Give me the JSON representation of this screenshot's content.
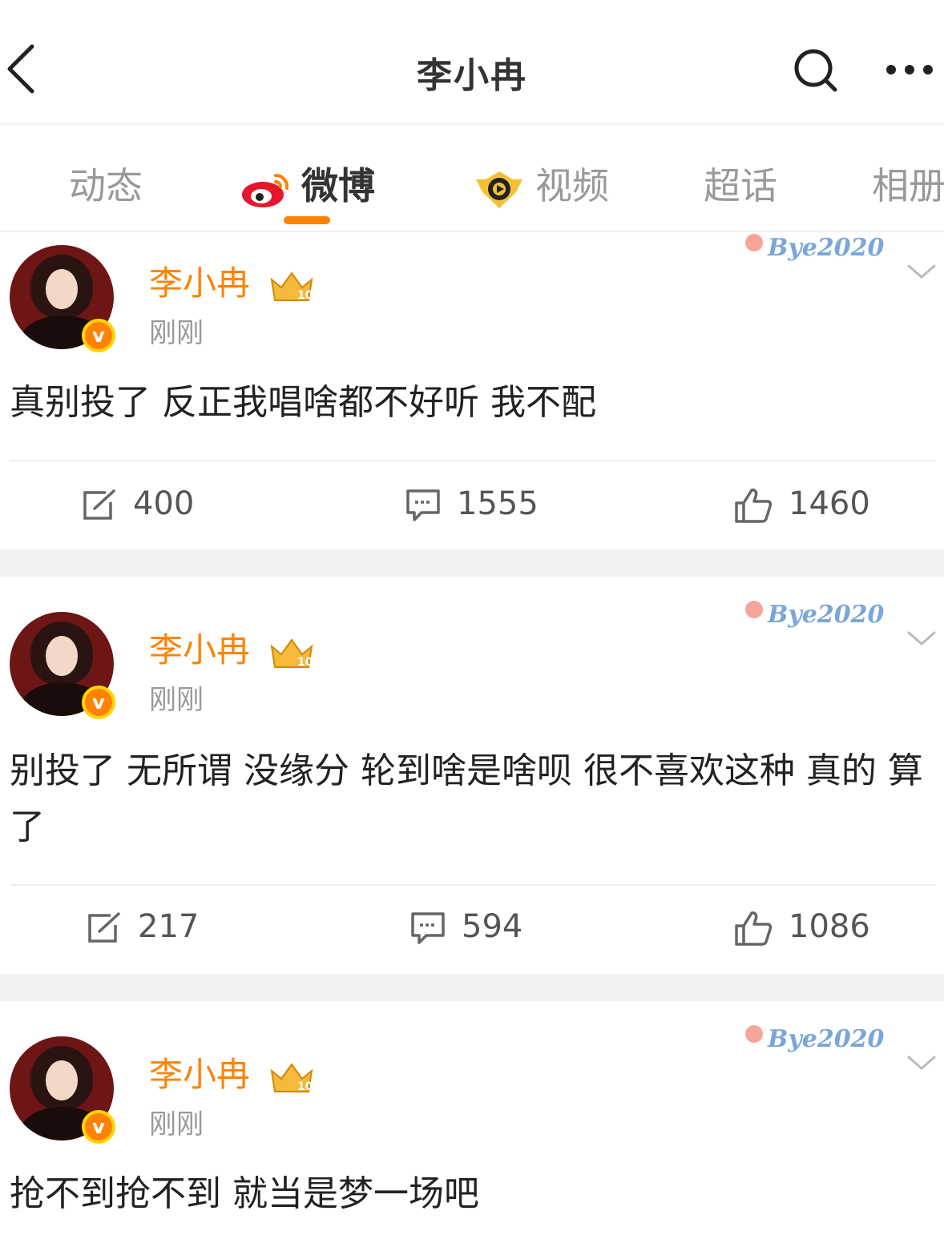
{
  "header": {
    "title": "李小冉"
  },
  "tabs": [
    {
      "label": "动态"
    },
    {
      "label": "微博"
    },
    {
      "label": "视频"
    },
    {
      "label": "超话"
    },
    {
      "label": "相册"
    }
  ],
  "posts": [
    {
      "author": "李小冉",
      "time": "刚刚",
      "decoration": "Bye2020",
      "text": "真别投了 反正我唱啥都不好听 我不配",
      "reposts": "400",
      "comments": "1555",
      "likes": "1460"
    },
    {
      "author": "李小冉",
      "time": "刚刚",
      "decoration": "Bye2020",
      "text": "别投了 无所谓 没缘分 轮到啥是啥呗 很不喜欢这种 真的  算了",
      "reposts": "217",
      "comments": "594",
      "likes": "1086"
    },
    {
      "author": "李小冉",
      "time": "刚刚",
      "decoration": "Bye2020",
      "text": "抢不到抢不到 就当是梦一场吧"
    }
  ],
  "colors": {
    "accent": "#ff8200",
    "badge_ring": "#ffd400",
    "muted": "#999999"
  },
  "icons": [
    "back-icon",
    "search-icon",
    "more-icon",
    "weibo-logo-icon",
    "video-icon",
    "crown-badge-icon",
    "verified-icon",
    "chevron-down-icon",
    "repost-icon",
    "comment-icon",
    "like-icon"
  ]
}
